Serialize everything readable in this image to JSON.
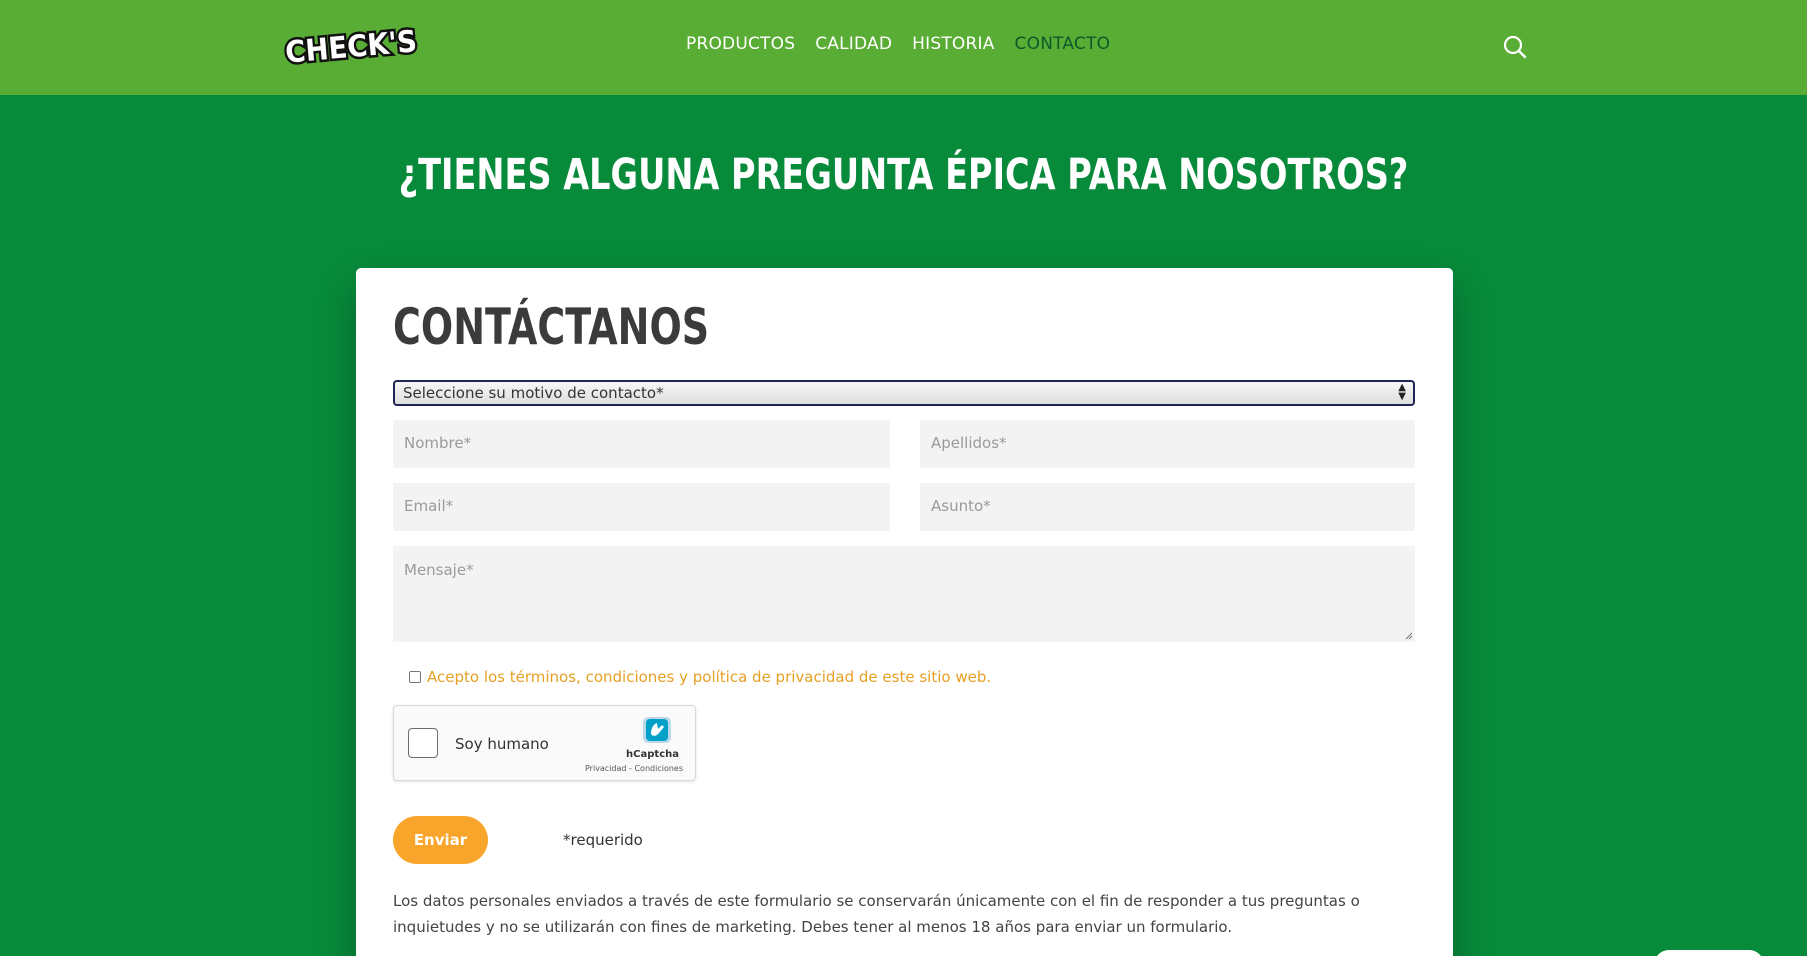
{
  "header": {
    "logo_text": "CHECK'S",
    "nav": [
      {
        "label": "PRODUCTOS"
      },
      {
        "label": "CALIDAD"
      },
      {
        "label": "HISTORIA"
      },
      {
        "label": "CONTACTO",
        "active": true
      }
    ],
    "search_icon": "search-icon"
  },
  "hero": {
    "headline": "¿TIENES ALGUNA PREGUNTA ÉPICA PARA NOSOTROS?"
  },
  "form": {
    "title": "CONTÁCTANOS",
    "select_value": "Seleccione su motivo de contacto*",
    "placeholders": {
      "nombre": "Nombre*",
      "apellidos": "Apellidos*",
      "email": "Email*",
      "asunto": "Asunto*",
      "mensaje": "Mensaje*"
    },
    "terms_label": "Acepto los términos, condiciones y política de privacidad de este sitio web.",
    "captcha": {
      "label": "Soy humano",
      "brand": "hCaptcha",
      "privacy": "Privacidad",
      "separator": "-",
      "conditions": "Condiciones"
    },
    "submit_label": "Enviar",
    "required_note": "*requerido",
    "disclaimer": "Los datos personales enviados a través de este formulario se conservarán únicamente con el fin de responder a tus preguntas o inquietudes y no se utilizarán con fines de marketing. Debes tener al menos 18 años para enviar un formulario."
  },
  "colors": {
    "header_bg": "#5aad34",
    "page_bg": "#078a3a",
    "accent_orange": "#f9a52b",
    "terms_text": "#e6a024",
    "nav_active": "#0a5a2a"
  }
}
